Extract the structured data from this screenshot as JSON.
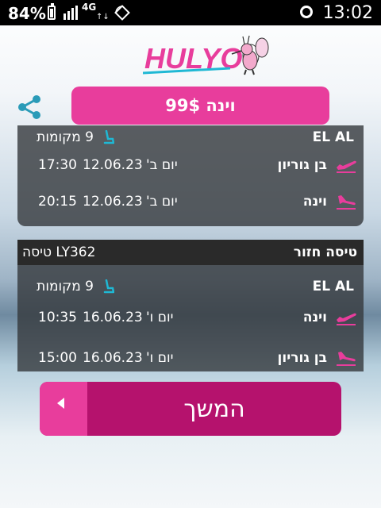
{
  "status_bar": {
    "battery": "84%",
    "network": "4G",
    "network_arrows": "↑↓",
    "time": "13:02"
  },
  "header": {
    "logo_text": "HULYO"
  },
  "price_button": {
    "label": "וינה 99$"
  },
  "outbound": {
    "airline": "EL AL",
    "seats": "9 מקומות",
    "departure": {
      "place": "בן גוריון",
      "day": "יום ב'",
      "date": "12.06.23",
      "time": "17:30"
    },
    "arrival": {
      "place": "וינה",
      "day": "יום ב'",
      "date": "12.06.23",
      "time": "20:15"
    }
  },
  "return": {
    "title": "טיסה חזור",
    "flight": "LY362 טיסה",
    "airline": "EL AL",
    "seats": "9 מקומות",
    "departure": {
      "place": "וינה",
      "day": "יום ו'",
      "date": "16.06.23",
      "time": "10:35"
    },
    "arrival": {
      "place": "בן גוריון",
      "day": "יום ו'",
      "date": "16.06.23",
      "time": "15:00"
    }
  },
  "continue_button": {
    "label": "המשך"
  },
  "colors": {
    "brand_pink": "#e83d9c",
    "dark_pink": "#b5126d",
    "seat_teal": "#1fb8d4",
    "card": "#34383c"
  }
}
